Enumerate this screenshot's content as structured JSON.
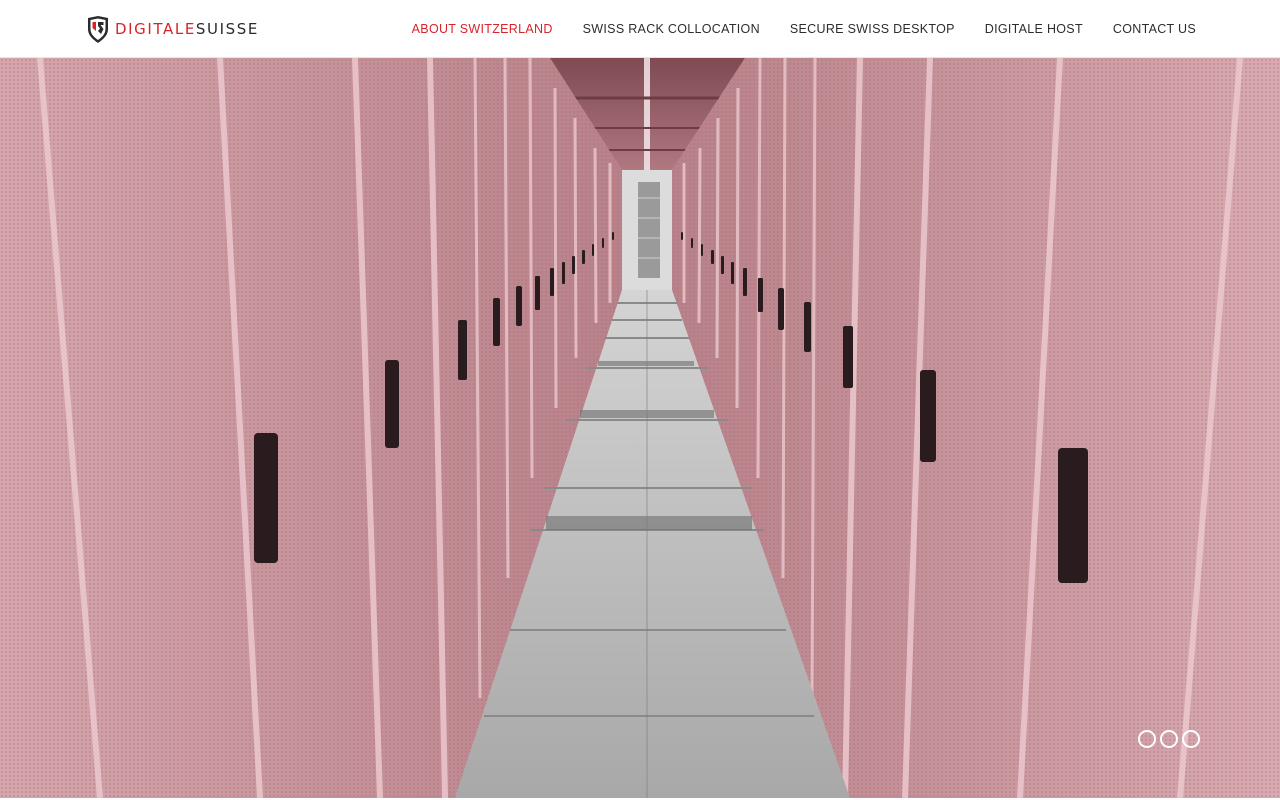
{
  "brand": {
    "name_part1": "DIGITALE",
    "name_part2": "SUISSE",
    "accent_color": "#d8232a",
    "logo_icon": "shield-logo-icon"
  },
  "nav": {
    "items": [
      {
        "label": "ABOUT SWITZERLAND",
        "active": true
      },
      {
        "label": "SWISS RACK COLLOCATION",
        "active": false
      },
      {
        "label": "SECURE SWISS DESKTOP",
        "active": false
      },
      {
        "label": "DIGITALE HOST",
        "active": false
      },
      {
        "label": "CONTACT US",
        "active": false
      }
    ]
  },
  "hero": {
    "image": "data-center-server-rack-corridor",
    "slide_count": 3
  }
}
